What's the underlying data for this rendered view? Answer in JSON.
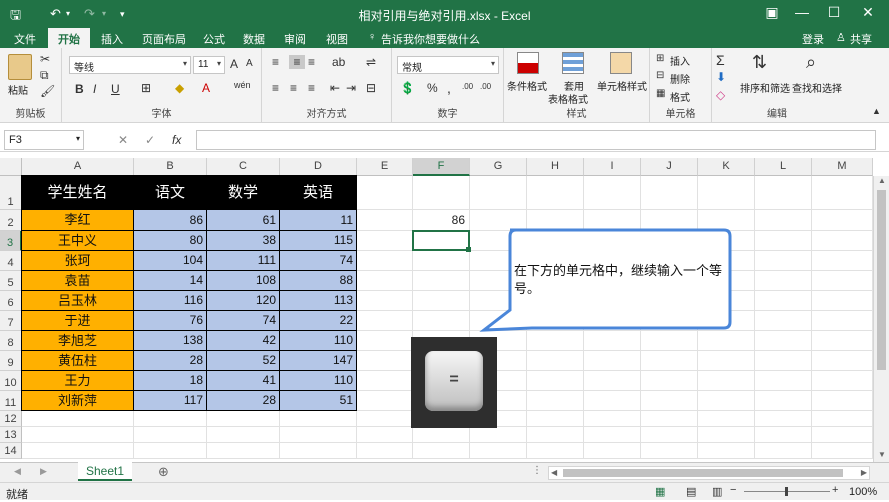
{
  "window": {
    "title": "相对引用与绝对引用.xlsx - Excel",
    "minimize": "—",
    "restore": "☐",
    "close": "✕"
  },
  "quick_access": {
    "save_icon": "save-icon",
    "undo_icon": "undo-icon",
    "redo_icon": "redo-icon"
  },
  "menu": {
    "tabs": [
      "文件",
      "开始",
      "插入",
      "页面布局",
      "公式",
      "数据",
      "审阅",
      "视图"
    ],
    "active_tab": "开始",
    "tell_me": "告诉我你想要做什么",
    "login": "登录",
    "share": "共享"
  },
  "ribbon": {
    "clipboard": {
      "paste": "粘贴",
      "label": "剪贴板"
    },
    "font": {
      "name": "等线",
      "size": "11",
      "label": "字体",
      "bold": "B",
      "italic": "I",
      "underline": "U",
      "grow": "A",
      "shrink": "A",
      "phonetic": "wén"
    },
    "alignment": {
      "label": "对齐方式"
    },
    "number": {
      "format": "常规",
      "label": "数字",
      "percent": "%",
      "comma": ",",
      "inc_dec": ".00"
    },
    "styles": {
      "conditional": "条件格式",
      "table": "套用\n表格格式",
      "table_l1": "套用",
      "table_l2": "表格格式",
      "cell": "单元格样式",
      "label": "样式"
    },
    "cells": {
      "insert": "插入",
      "delete": "删除",
      "format": "格式",
      "label": "单元格"
    },
    "editing": {
      "sort": "排序和筛选",
      "find": "查找和选择",
      "label": "编辑",
      "sum": "Σ"
    }
  },
  "formula_bar": {
    "name_box": "F3",
    "fx": "fx",
    "cancel": "✕",
    "enter": "✓",
    "value": ""
  },
  "columns": [
    "A",
    "B",
    "C",
    "D",
    "E",
    "F",
    "G",
    "H",
    "I",
    "J",
    "K",
    "L",
    "M"
  ],
  "rows": [
    "1",
    "2",
    "3",
    "4",
    "5",
    "6",
    "7",
    "8",
    "9",
    "10",
    "11",
    "12",
    "13",
    "14"
  ],
  "table": {
    "headers": [
      "学生姓名",
      "语文",
      "数学",
      "英语"
    ],
    "rows": [
      [
        "李红",
        "86",
        "61",
        "11"
      ],
      [
        "王中义",
        "80",
        "38",
        "115"
      ],
      [
        "张珂",
        "104",
        "111",
        "74"
      ],
      [
        "袁苗",
        "14",
        "108",
        "88"
      ],
      [
        "吕玉林",
        "116",
        "120",
        "113"
      ],
      [
        "于进",
        "76",
        "74",
        "22"
      ],
      [
        "李旭芝",
        "138",
        "42",
        "110"
      ],
      [
        "黄伍柱",
        "28",
        "52",
        "147"
      ],
      [
        "王力",
        "18",
        "41",
        "110"
      ],
      [
        "刘新萍",
        "117",
        "28",
        "51"
      ]
    ]
  },
  "cell_F2": "86",
  "callout": "在下方的单元格中，继续输入一个等号。",
  "key": "=",
  "sheet_tab": "Sheet1",
  "status": {
    "ready": "就绪",
    "zoom": "100%"
  },
  "colors": {
    "excel_green": "#217346",
    "header_black": "#000000",
    "name_orange": "#ffb000",
    "score_blue": "#b4c6e7",
    "callout_border": "#4a86d9"
  }
}
